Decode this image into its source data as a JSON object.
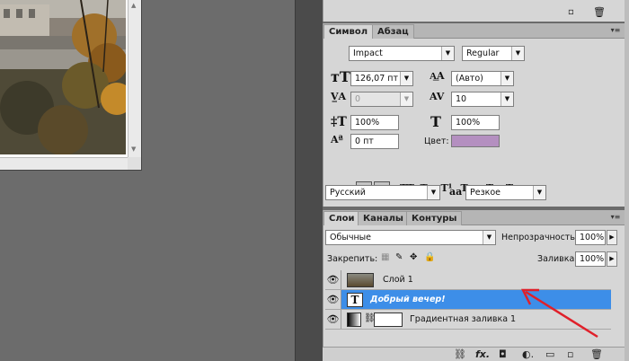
{
  "character_panel": {
    "tabs": [
      "Символ",
      "Абзац"
    ],
    "font_family": "Impact",
    "font_style": "Regular",
    "font_size": "126,07 пт",
    "leading": "(Авто)",
    "kerning": "0",
    "tracking": "10",
    "vertical_scale": "100%",
    "horizontal_scale": "100%",
    "baseline_shift": "0 пт",
    "color_label": "Цвет:",
    "color_swatch": "#b48fc0",
    "style_buttons": [
      "T",
      "T",
      "TT",
      "Tт",
      "T¹",
      "T₁",
      "T",
      "T"
    ],
    "language": "Русский",
    "antialias_icon": "aa",
    "antialias": "Резкое"
  },
  "layers_panel": {
    "tabs": [
      "Слои",
      "Каналы",
      "Контуры"
    ],
    "blend_mode": "Обычные",
    "opacity_label": "Непрозрачность:",
    "opacity": "100%",
    "lock_label": "Закрепить:",
    "fill_label": "Заливка:",
    "fill": "100%",
    "layers": [
      {
        "name": "Слой 1",
        "selected": false
      },
      {
        "name": "Добрый  вечер!",
        "selected": true
      },
      {
        "name": "Градиентная заливка 1",
        "selected": false
      }
    ],
    "bottom_icons": [
      "link-icon",
      "fx-icon",
      "mask-icon",
      "adjustment-icon",
      "folder-icon",
      "new-layer-icon",
      "trash-icon"
    ]
  },
  "colors": {
    "selection": "#3d8ee8",
    "arrow": "#e0202a"
  }
}
